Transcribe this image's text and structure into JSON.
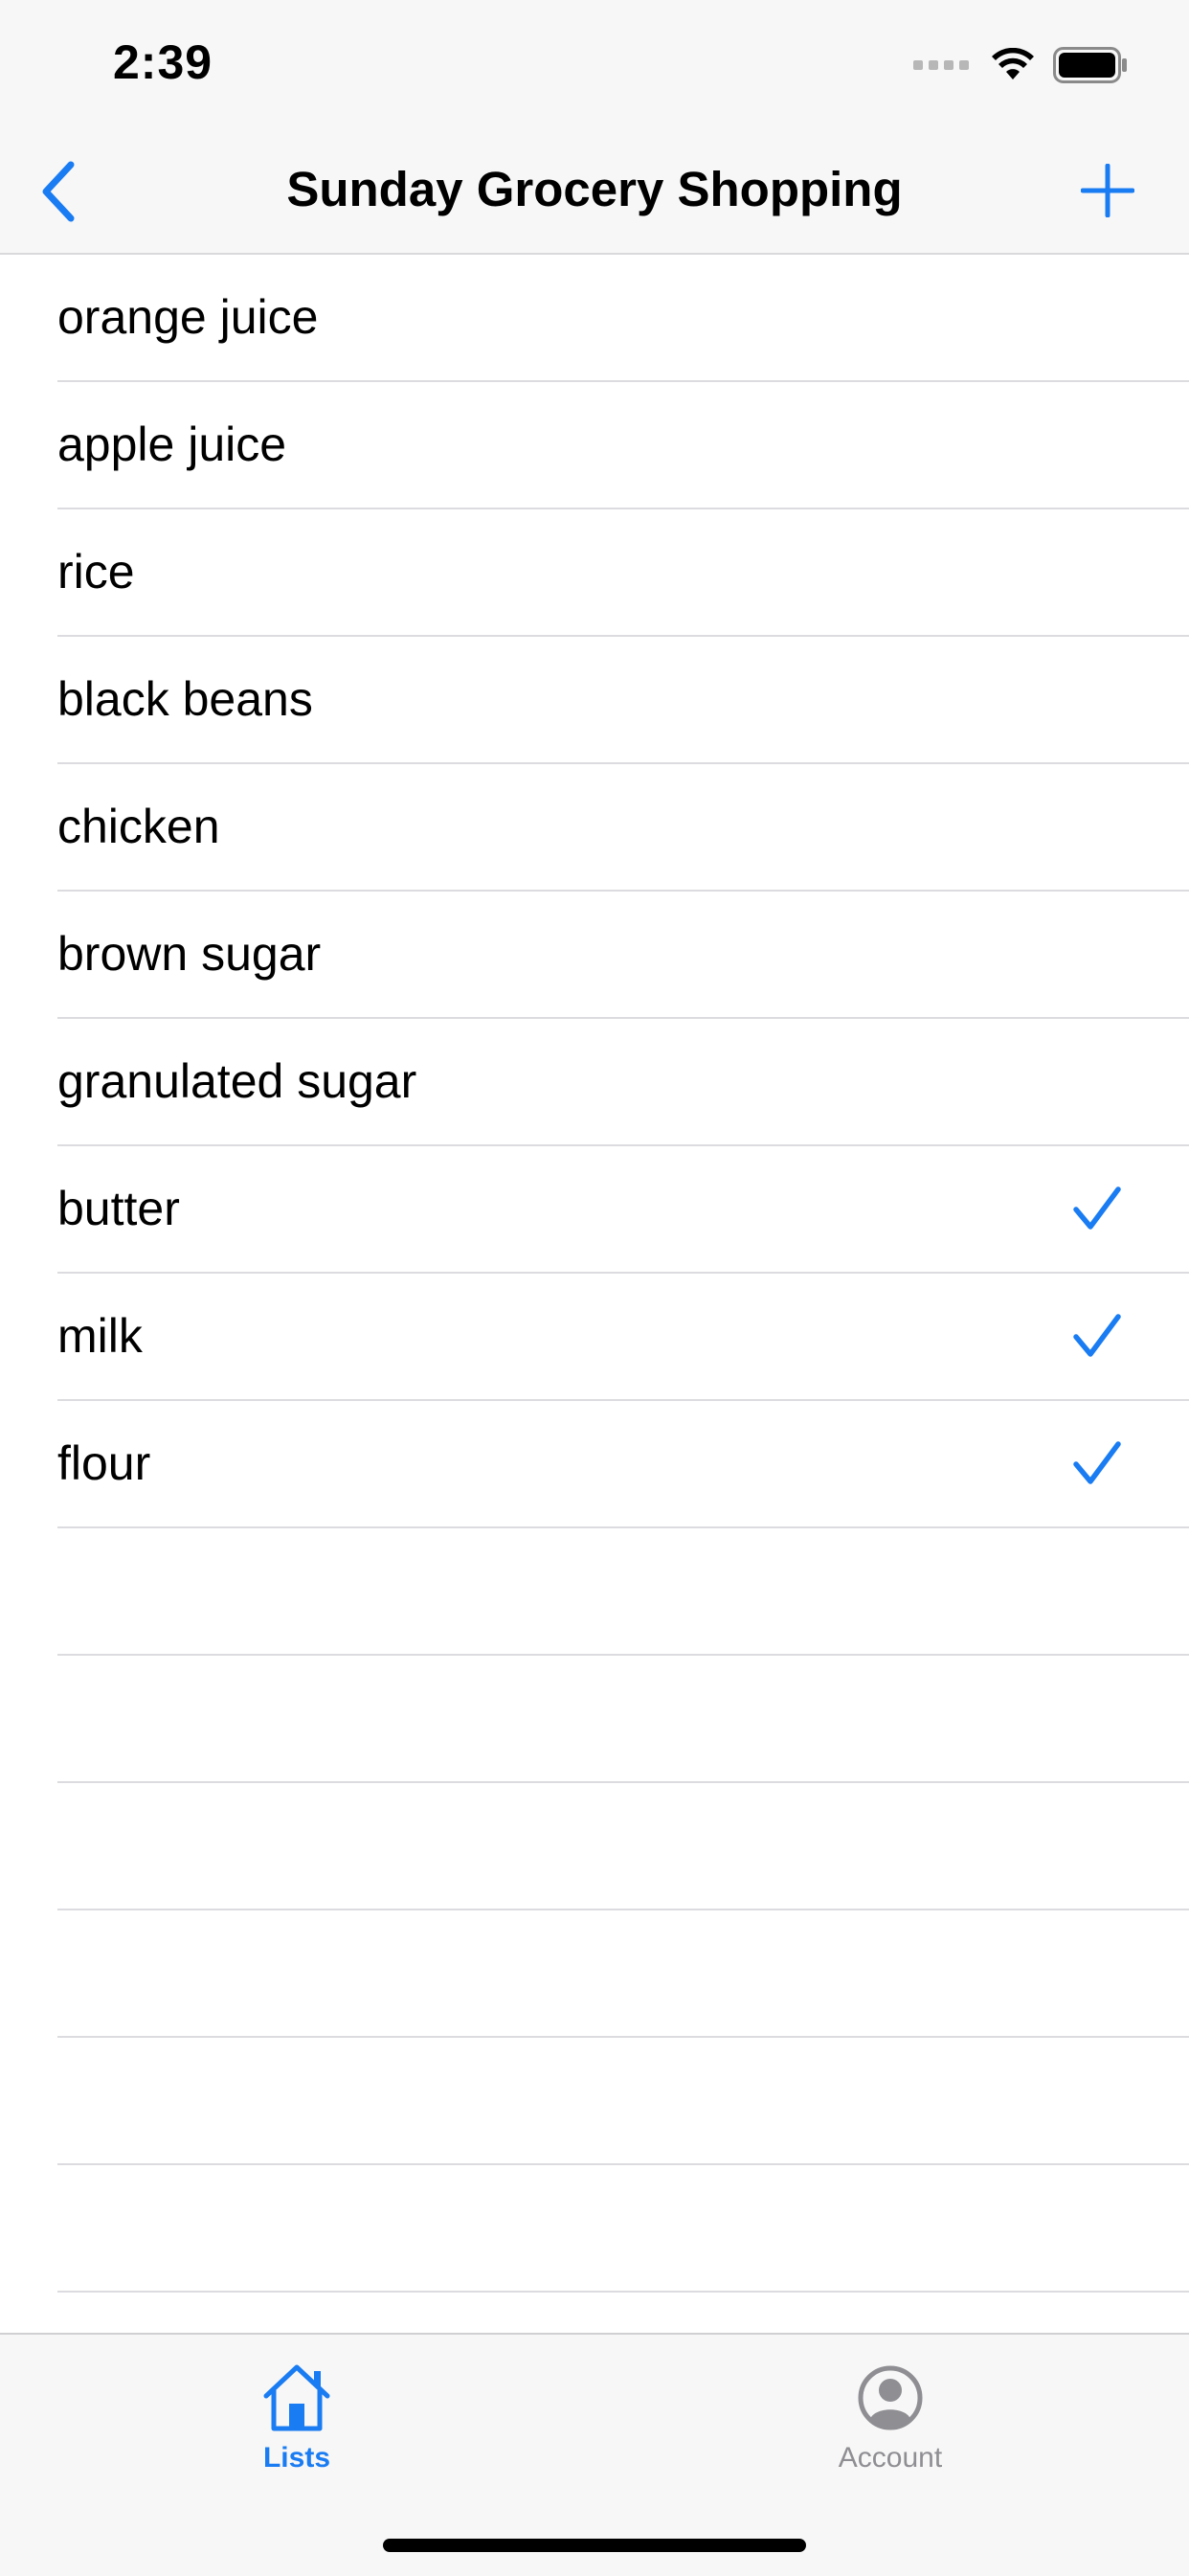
{
  "status_bar": {
    "time": "2:39"
  },
  "nav": {
    "title": "Sunday Grocery Shopping",
    "back_icon": "chevron-left-icon",
    "add_icon": "plus-icon"
  },
  "items": [
    {
      "label": "orange juice",
      "checked": false
    },
    {
      "label": "apple juice",
      "checked": false
    },
    {
      "label": "rice",
      "checked": false
    },
    {
      "label": "black beans",
      "checked": false
    },
    {
      "label": "chicken",
      "checked": false
    },
    {
      "label": "brown sugar",
      "checked": false
    },
    {
      "label": "granulated sugar",
      "checked": false
    },
    {
      "label": "butter",
      "checked": true
    },
    {
      "label": "milk",
      "checked": true
    },
    {
      "label": "flour",
      "checked": true
    }
  ],
  "tabs": [
    {
      "label": "Lists",
      "icon": "house-icon",
      "active": true
    },
    {
      "label": "Account",
      "icon": "person-circle-icon",
      "active": false
    }
  ],
  "colors": {
    "accent": "#1a7cf2",
    "inactive": "#8e8e93",
    "separator": "#dcdce0",
    "bar_background": "#f7f7f7"
  }
}
